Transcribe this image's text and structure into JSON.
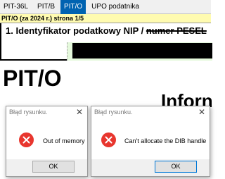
{
  "tabs": [
    {
      "label": "PIT-36L",
      "active": false
    },
    {
      "label": "PIT/B",
      "active": false
    },
    {
      "label": "PIT/O",
      "active": true
    },
    {
      "label": "UPO podatnika",
      "active": false
    }
  ],
  "form": {
    "header": "PIT/O (za 2024 r.) strona 1/5",
    "section_title": "1. Identyfikator podatkowy NIP / ",
    "section_title_struck": "numer PESEL",
    "big_title": "PIT/O",
    "info_text": "Inforn"
  },
  "dialogs": [
    {
      "title": "Błąd rysunku.",
      "message": "Out of memory",
      "ok_label": "OK",
      "close_glyph": "✕",
      "icon": "error-icon"
    },
    {
      "title": "Błąd rysunku.",
      "message": "Can't allocate the DIB handle",
      "ok_label": "OK",
      "close_glyph": "✕",
      "icon": "error-icon"
    }
  ],
  "colors": {
    "tab_active": "#0063b1",
    "form_header_bg": "#fffbb0",
    "field_bg": "#e5f9dc",
    "error_icon": "#e8362e",
    "focus_border": "#0078d7"
  }
}
